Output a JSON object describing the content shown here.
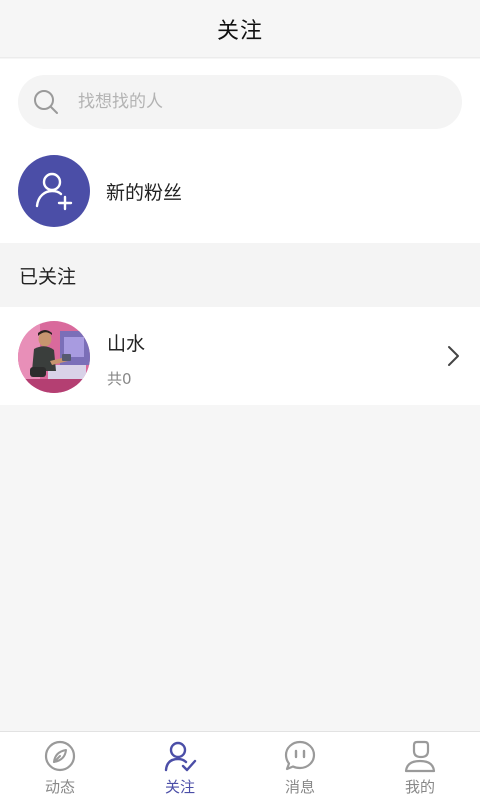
{
  "header": {
    "title": "关注"
  },
  "search": {
    "placeholder": "找想找的人",
    "value": ""
  },
  "new_fans": {
    "label": "新的粉丝",
    "icon": "add-user-icon"
  },
  "followed": {
    "section_title": "已关注",
    "items": [
      {
        "name": "山水",
        "count_text": "共0",
        "icon": "chevron-right-icon"
      }
    ]
  },
  "tabbar": {
    "items": [
      {
        "label": "动态",
        "icon": "leaf-compass-icon",
        "active": false
      },
      {
        "label": "关注",
        "icon": "user-check-icon",
        "active": true
      },
      {
        "label": "消息",
        "icon": "chat-bubble-icon",
        "active": false
      },
      {
        "label": "我的",
        "icon": "user-icon",
        "active": false
      }
    ]
  },
  "colors": {
    "accent": "#4b4ea7",
    "background": "#f6f6f6",
    "inactive": "#888888"
  }
}
